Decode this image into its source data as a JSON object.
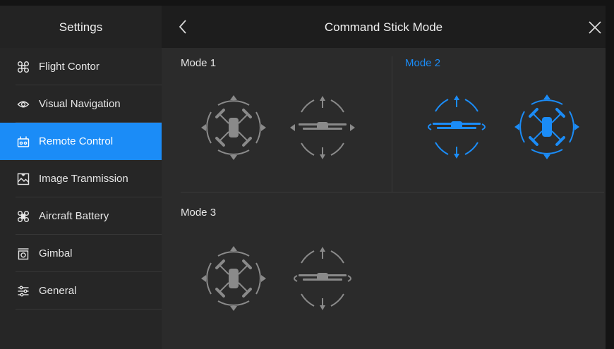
{
  "sidebar": {
    "title": "Settings",
    "items": [
      {
        "label": "Flight Contor",
        "icon": "drone-icon"
      },
      {
        "label": "Visual Navigation",
        "icon": "eye-icon"
      },
      {
        "label": "Remote Control",
        "icon": "remote-controller-icon"
      },
      {
        "label": "Image Tranmission",
        "icon": "image-transmission-icon"
      },
      {
        "label": "Aircraft Battery",
        "icon": "battery-drone-icon"
      },
      {
        "label": "Gimbal",
        "icon": "gimbal-icon"
      },
      {
        "label": "General",
        "icon": "sliders-icon"
      }
    ],
    "active_item": "Remote Control"
  },
  "header": {
    "title": "Command Stick Mode",
    "back_icon": "chevron-left-icon",
    "close_icon": "close-icon"
  },
  "modes": [
    {
      "label": "Mode 1",
      "selected": false,
      "left_stick": "drone-top-view-icon",
      "right_stick": "drone-side-view-icon"
    },
    {
      "label": "Mode 2",
      "selected": true,
      "left_stick": "drone-side-view-icon",
      "right_stick": "drone-top-view-icon"
    },
    {
      "label": "Mode 3",
      "selected": false,
      "left_stick": "drone-top-view-icon",
      "right_stick": "drone-side-view-icon"
    }
  ],
  "colors": {
    "accent": "#1b8cf7",
    "sidebar_bg": "#262626",
    "content_bg": "#2b2b2b",
    "header_bg": "#1d1d1d",
    "icon_gray": "#8a8a8a"
  }
}
